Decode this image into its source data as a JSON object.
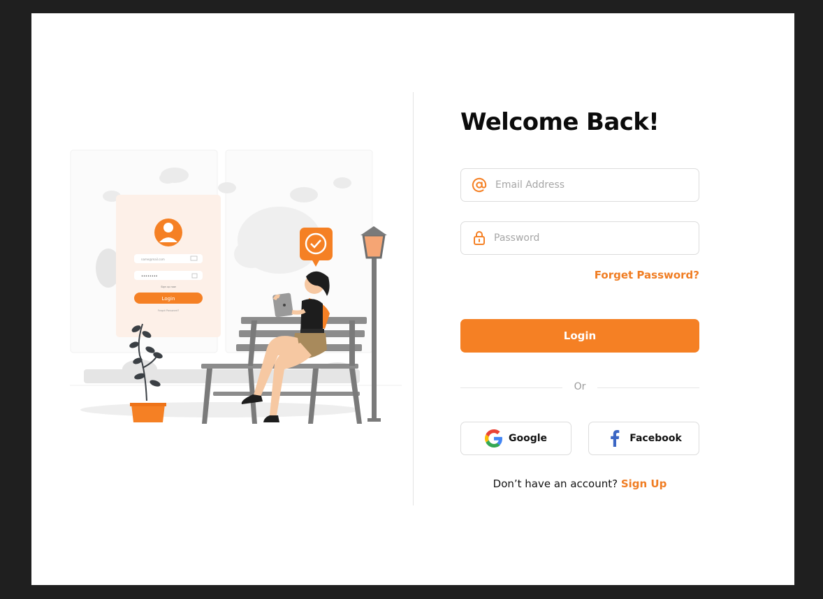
{
  "colors": {
    "accent": "#f58024",
    "outer_background": "#1f1f1f",
    "card_background": "#ffffff"
  },
  "illustration": {
    "name": "login illustration",
    "mini_form": {
      "email_placeholder": "name@mail.com",
      "password_masked": "••••••••",
      "sign_up_text": "Sign up now",
      "login_label": "Login",
      "forgot_text": "Forgot Password?"
    }
  },
  "login": {
    "title": "Welcome Back!",
    "email": {
      "icon": "at-sign-icon",
      "placeholder": "Email Address",
      "value": ""
    },
    "password": {
      "icon": "lock-icon",
      "placeholder": "Password",
      "value": ""
    },
    "forgot_password": "Forget Password?",
    "login_button": "Login",
    "divider_text": "Or",
    "social": [
      {
        "name": "Google",
        "icon": "google-icon"
      },
      {
        "name": "Facebook",
        "icon": "facebook-icon"
      }
    ],
    "signup_prompt": "Don’t have an account?",
    "signup_link": "Sign Up"
  }
}
